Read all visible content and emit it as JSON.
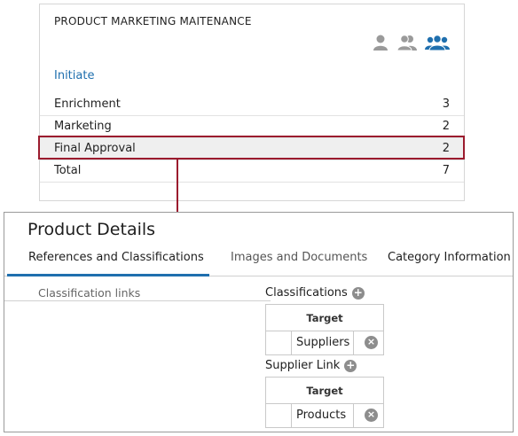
{
  "workflow": {
    "title": "PRODUCT MARKETING MAITENANCE",
    "initiate_label": "Initiate",
    "rows": [
      {
        "label": "Enrichment",
        "count": "3"
      },
      {
        "label": "Marketing",
        "count": "2"
      },
      {
        "label": "Final Approval",
        "count": "2",
        "selected": true
      },
      {
        "label": "Total",
        "count": "7"
      }
    ],
    "icons": [
      "single-user-icon",
      "two-users-icon",
      "group-users-icon"
    ],
    "highlight_color": "#9b1b2e",
    "active_icon_color": "#1f6fae"
  },
  "product_details": {
    "title": "Product Details",
    "tabs": [
      {
        "label": "References and Classifications",
        "active": true
      },
      {
        "label": "Images and Documents",
        "active": false
      },
      {
        "label": "Category Information",
        "active": false
      }
    ],
    "classification_links_label": "Classification links",
    "classifications": {
      "label": "Classifications",
      "column_header": "Target",
      "rows": [
        {
          "value": "Suppliers"
        }
      ]
    },
    "supplier_link": {
      "label": "Supplier Link",
      "column_header": "Target",
      "rows": [
        {
          "value": "Products"
        }
      ]
    },
    "accent_color": "#1f6fae"
  }
}
